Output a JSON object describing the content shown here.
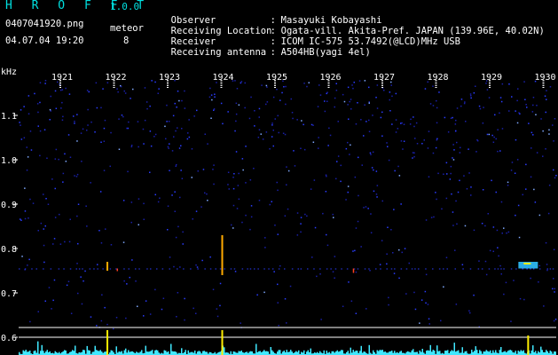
{
  "app": {
    "title": "H R O F F T",
    "version": "1.0.0"
  },
  "recording": {
    "file_name": "0407041920.png",
    "datetime": "04.07.04 19:20",
    "meteor_label": "meteor",
    "meteor_count": "8"
  },
  "station": [
    {
      "label": "Observer",
      "sep": ":",
      "value": "Masayuki Kobayashi"
    },
    {
      "label": "Receiving Location",
      "sep": ":",
      "value": "Ogata-vill. Akita-Pref. JAPAN (139.96E, 40.02N)"
    },
    {
      "label": "Receiver",
      "sep": ":",
      "value": "ICOM IC-575 53.7492(@LCD)MHz USB"
    },
    {
      "label": "Receiving antenna",
      "sep": ":",
      "value": "A504HB(yagi 4el)"
    }
  ],
  "colors": {
    "title": "#00e0e0",
    "noise": "#2a3cff",
    "echo": "#ffee00",
    "hot": "#ff4020",
    "level": "#40e8ff",
    "frame": "#ffffff"
  },
  "chart_data": {
    "type": "heatmap",
    "ylabel": "kHz",
    "x_ticks": [
      "1921",
      "1922",
      "1923",
      "1924",
      "1925",
      "1926",
      "1927",
      "1928",
      "1929",
      "1930"
    ],
    "y_ticks": [
      "1.1",
      "1.0",
      "0.9",
      "0.8",
      "0.7",
      "0.6"
    ],
    "y_range": [
      0.6,
      1.2
    ],
    "echo_events": [
      {
        "minute": 1921.86,
        "khz_top": 0.77,
        "khz_bottom": 0.75,
        "intensity": "strong"
      },
      {
        "minute": 1922.05,
        "khz_top": 0.755,
        "khz_bottom": 0.75,
        "intensity": "weak"
      },
      {
        "minute": 1924.0,
        "khz_top": 0.83,
        "khz_bottom": 0.74,
        "intensity": "strong"
      },
      {
        "minute": 1926.45,
        "khz_top": 0.755,
        "khz_bottom": 0.745,
        "intensity": "weak"
      },
      {
        "minute": 1929.7,
        "khz_top": 0.77,
        "khz_bottom": 0.755,
        "intensity": "strong"
      }
    ]
  }
}
